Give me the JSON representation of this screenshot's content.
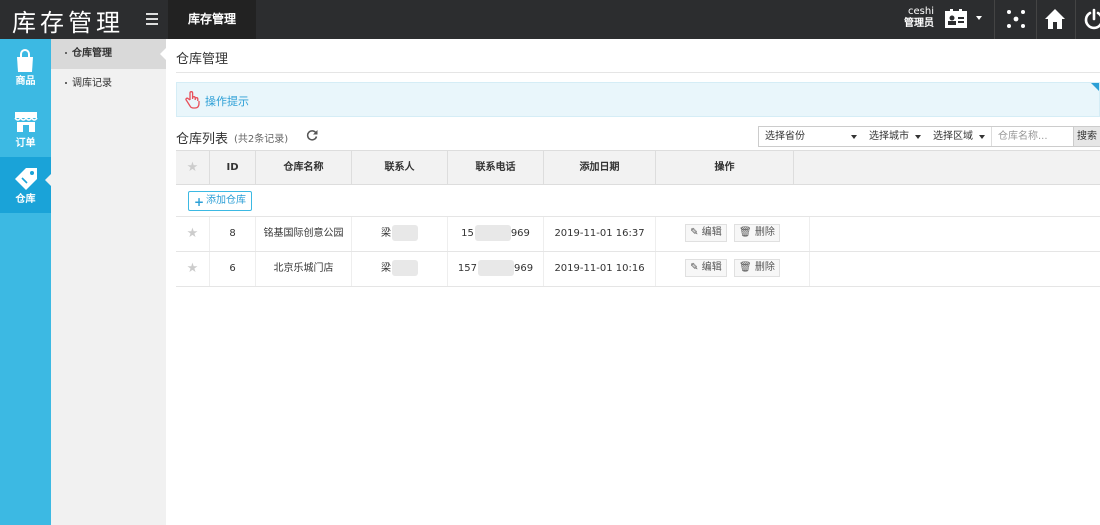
{
  "app": {
    "title": "库存管理",
    "top_tab": "库存管理"
  },
  "user": {
    "name": "ceshi",
    "role": "管理员"
  },
  "icons": {
    "header": [
      "menu-icon",
      "id-card-icon",
      "chevron-down-icon",
      "apps-icon",
      "home-icon",
      "power-icon"
    ],
    "sidebar": [
      "shopping-bag-icon",
      "store-icon",
      "tag-icon"
    ]
  },
  "sidebar": {
    "items": [
      {
        "label": "商品"
      },
      {
        "label": "订单"
      },
      {
        "label": "仓库"
      }
    ]
  },
  "subnav": {
    "items": [
      {
        "label": "仓库管理"
      },
      {
        "label": "调库记录"
      }
    ]
  },
  "main": {
    "page_title": "仓库管理",
    "tip_label": "操作提示",
    "list_title": "仓库列表",
    "list_count": "(共2条记录)",
    "filters": {
      "province": "选择省份",
      "city": "选择城市",
      "district": "选择区域",
      "name_placeholder": "仓库名称...",
      "search_label": "搜索"
    },
    "table": {
      "columns": [
        "ID",
        "仓库名称",
        "联系人",
        "联系电话",
        "添加日期",
        "操作"
      ],
      "add_label": "添加仓库",
      "rows": [
        {
          "id": "8",
          "name": "铭基国际创意公园",
          "contact": "梁",
          "phone_prefix": "15",
          "phone_suffix": "969",
          "date": "2019-11-01 16:37",
          "edit": "编辑",
          "delete": "删除"
        },
        {
          "id": "6",
          "name": "北京乐城门店",
          "contact": "梁",
          "phone_prefix": "157",
          "phone_suffix": "969",
          "date": "2019-11-01 10:16",
          "edit": "编辑",
          "delete": "删除"
        }
      ]
    }
  },
  "colors": {
    "sidebar": "#3cb9e3",
    "topbar": "#2c2d2f",
    "accent": "#2c9fd6"
  }
}
